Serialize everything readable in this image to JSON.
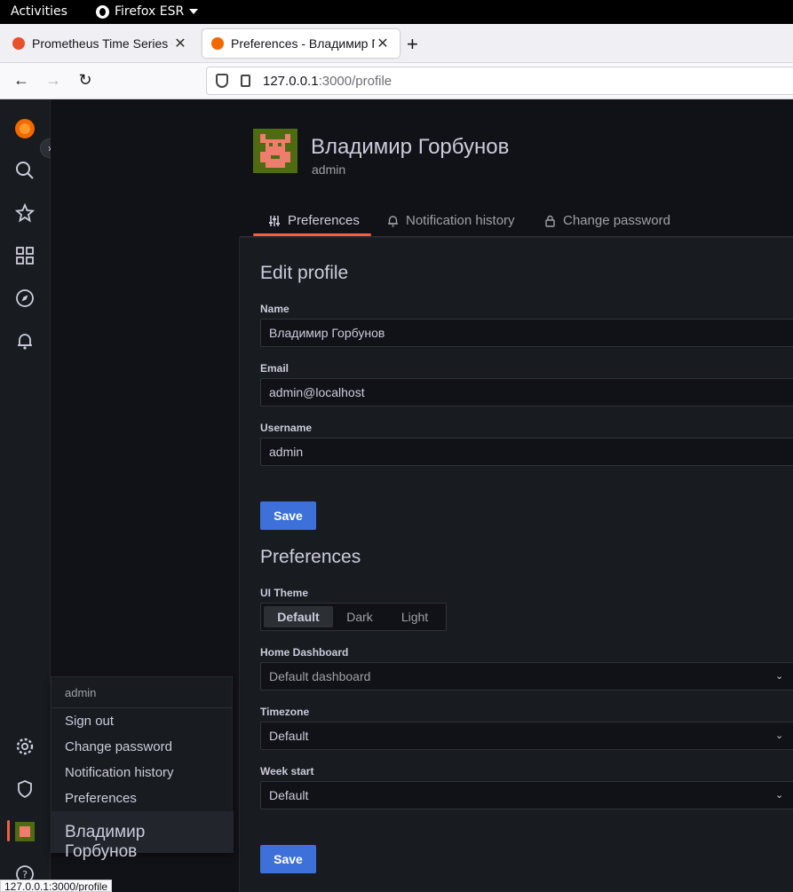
{
  "os": {
    "activities": "Activities",
    "app_menu": "Firefox ESR"
  },
  "browser": {
    "tabs": [
      {
        "title": "Prometheus Time Series C"
      },
      {
        "title": "Preferences - Владимир Г"
      }
    ],
    "url_host": "127.0.0.1",
    "url_path": ":3000/profile",
    "status_link": "127.0.0.1:3000/profile"
  },
  "profile": {
    "name": "Владимир Горбунов",
    "login": "admin"
  },
  "page_tabs": [
    {
      "label": "Preferences",
      "icon": "sliders-icon",
      "active": true
    },
    {
      "label": "Notification history",
      "icon": "bell-icon",
      "active": false
    },
    {
      "label": "Change password",
      "icon": "lock-icon",
      "active": false
    }
  ],
  "edit_profile": {
    "heading": "Edit profile",
    "name_label": "Name",
    "name_value": "Владимир Горбунов",
    "email_label": "Email",
    "email_value": "admin@localhost",
    "username_label": "Username",
    "username_value": "admin",
    "save": "Save"
  },
  "preferences": {
    "heading": "Preferences",
    "theme_label": "UI Theme",
    "theme_options": [
      "Default",
      "Dark",
      "Light"
    ],
    "theme_selected": "Default",
    "home_label": "Home Dashboard",
    "home_placeholder": "Default dashboard",
    "tz_label": "Timezone",
    "tz_value": "Default",
    "week_label": "Week start",
    "week_value": "Default",
    "save": "Save"
  },
  "user_menu": {
    "header": "admin",
    "items": [
      "Sign out",
      "Change password",
      "Notification history",
      "Preferences"
    ],
    "name": "Владимир Горбунов"
  },
  "colors": {
    "accent": "#f55f3e",
    "primary_button": "#3d71d9",
    "background": "#111217",
    "panel": "#181b1f"
  }
}
